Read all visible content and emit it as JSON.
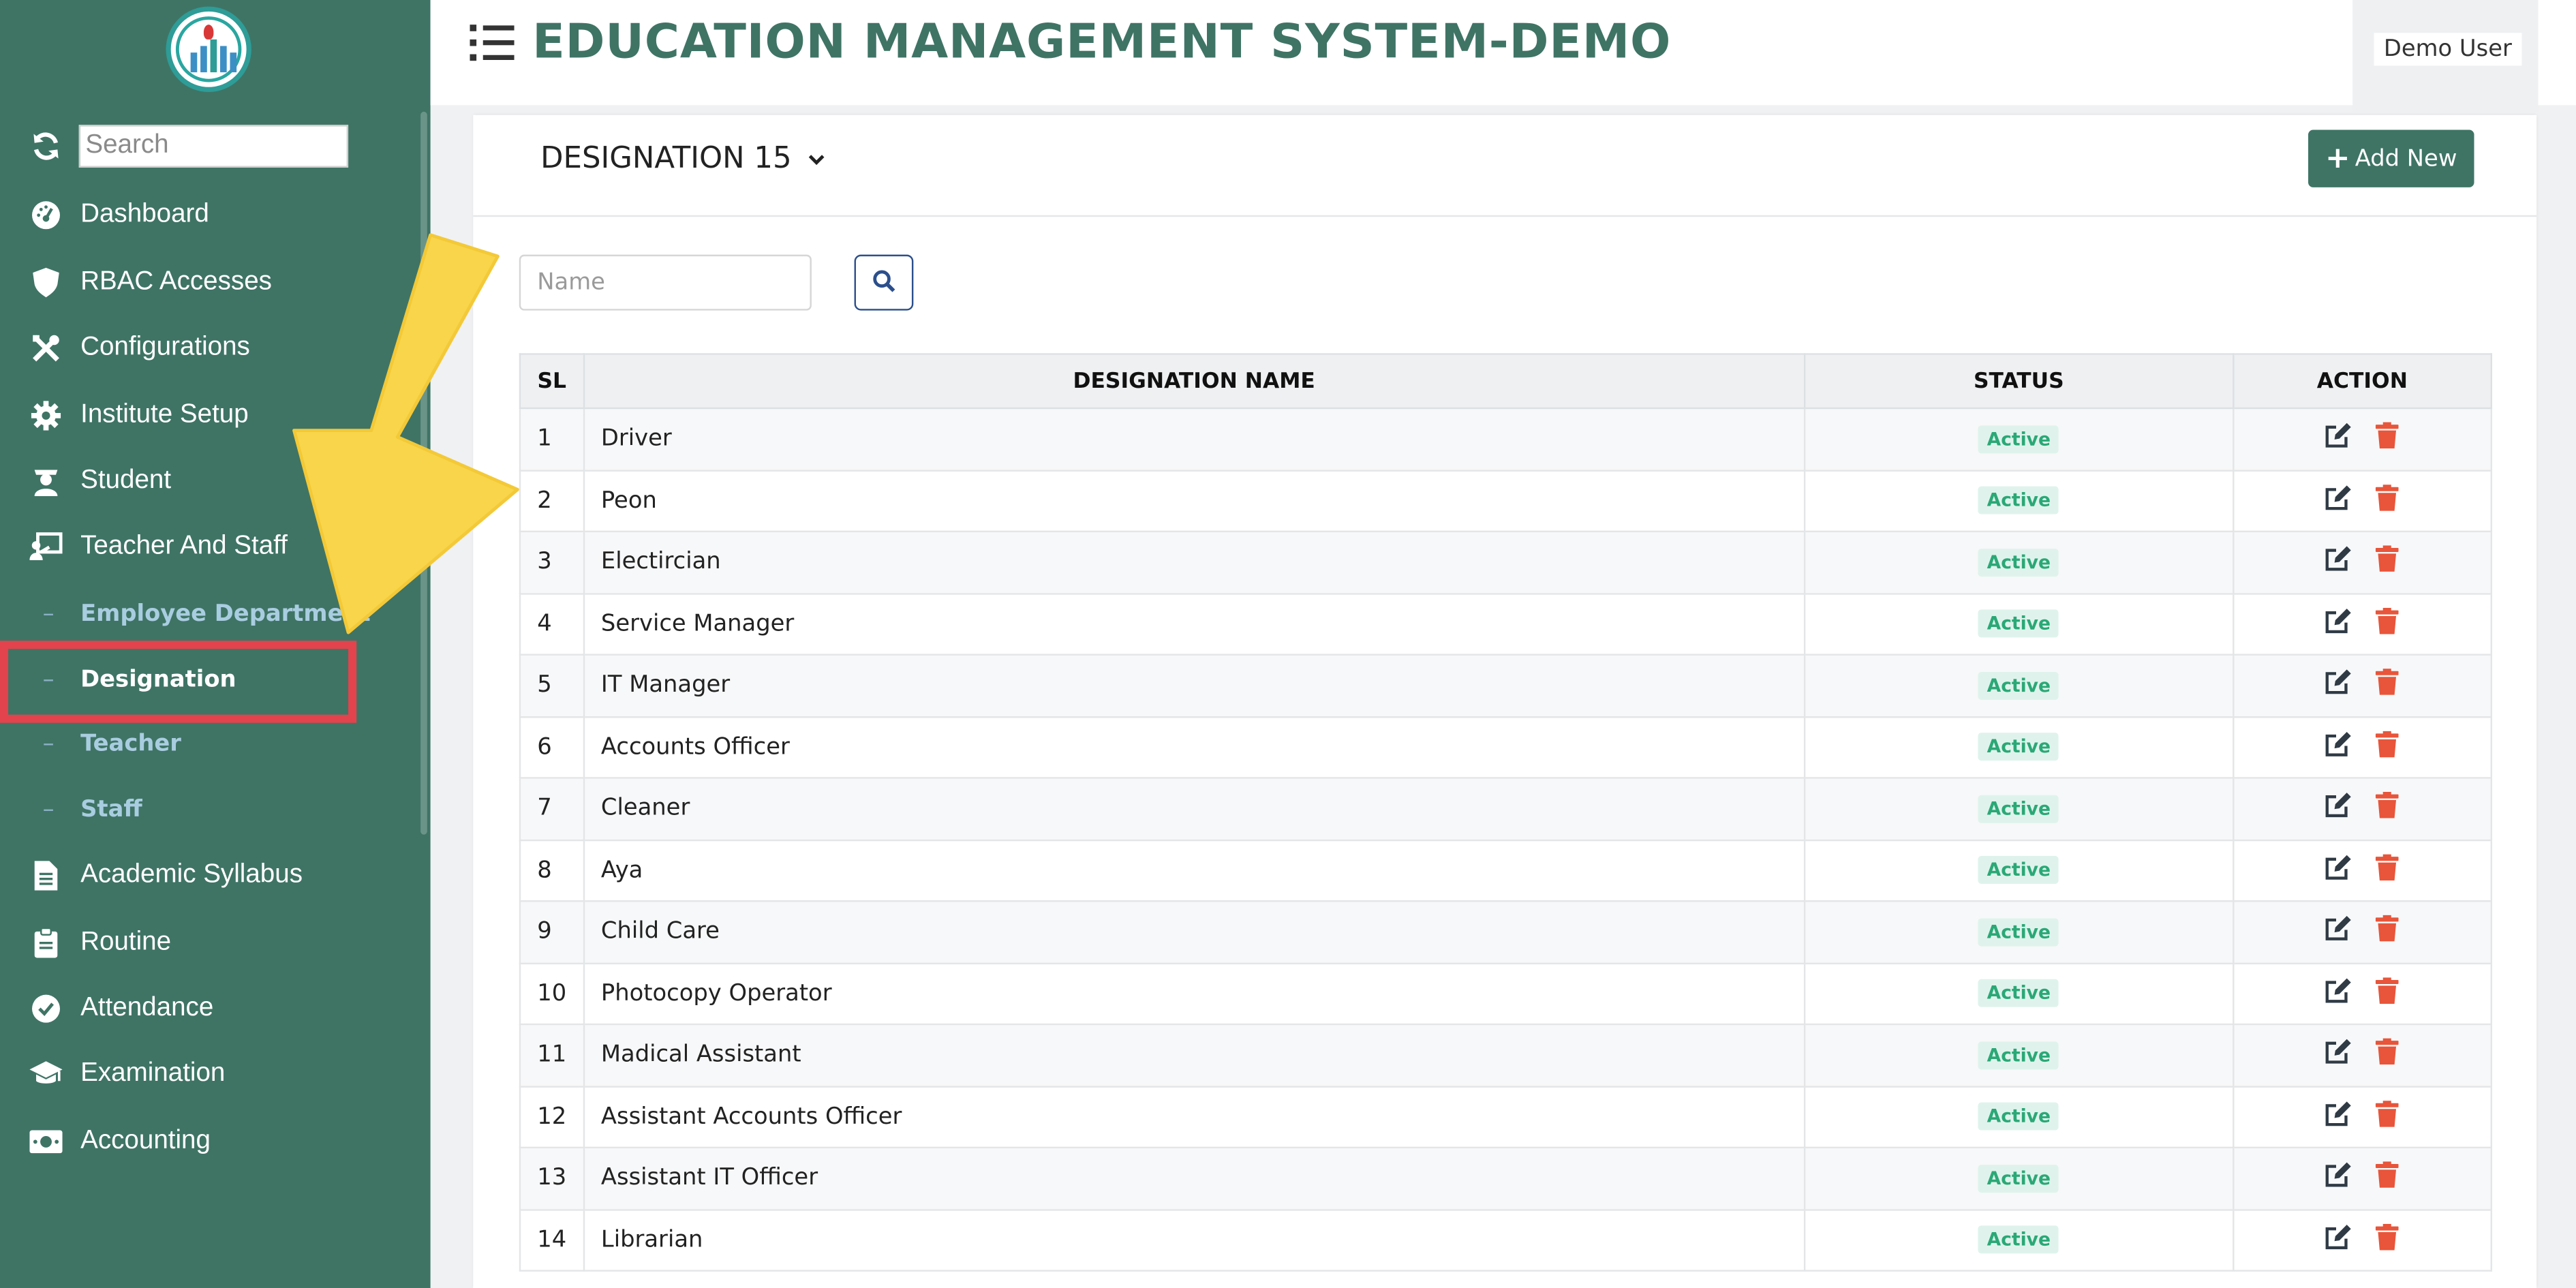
{
  "app": {
    "title": "EDUCATION MANAGEMENT SYSTEM-DEMO",
    "user": "Demo User"
  },
  "sidebar": {
    "search_placeholder": "Search",
    "items": [
      {
        "label": "Dashboard",
        "icon": "dashboard-icon"
      },
      {
        "label": "RBAC Accesses",
        "icon": "shield-icon"
      },
      {
        "label": "Configurations",
        "icon": "tools-icon"
      },
      {
        "label": "Institute Setup",
        "icon": "gear-icon"
      },
      {
        "label": "Student",
        "icon": "student-icon"
      },
      {
        "label": "Teacher And Staff",
        "icon": "teacher-icon"
      },
      {
        "label": "Academic Syllabus",
        "icon": "document-icon"
      },
      {
        "label": "Routine",
        "icon": "clipboard-icon"
      },
      {
        "label": "Attendance",
        "icon": "check-circle-icon"
      },
      {
        "label": "Examination",
        "icon": "graduation-cap-icon"
      },
      {
        "label": "Accounting",
        "icon": "money-icon"
      }
    ],
    "subitems": [
      {
        "label": "Employee Department"
      },
      {
        "label": "Designation",
        "active": true
      },
      {
        "label": "Teacher"
      },
      {
        "label": "Staff"
      }
    ]
  },
  "page": {
    "title": "DESIGNATION 15",
    "add_label": "Add New",
    "name_placeholder": "Name"
  },
  "table": {
    "headers": [
      "SL",
      "DESIGNATION NAME",
      "STATUS",
      "ACTION"
    ],
    "rows": [
      {
        "sl": "1",
        "name": "Driver",
        "status": "Active"
      },
      {
        "sl": "2",
        "name": "Peon",
        "status": "Active"
      },
      {
        "sl": "3",
        "name": "Electircian",
        "status": "Active"
      },
      {
        "sl": "4",
        "name": "Service Manager",
        "status": "Active"
      },
      {
        "sl": "5",
        "name": "IT Manager",
        "status": "Active"
      },
      {
        "sl": "6",
        "name": "Accounts Officer",
        "status": "Active"
      },
      {
        "sl": "7",
        "name": "Cleaner",
        "status": "Active"
      },
      {
        "sl": "8",
        "name": "Aya",
        "status": "Active"
      },
      {
        "sl": "9",
        "name": "Child Care",
        "status": "Active"
      },
      {
        "sl": "10",
        "name": "Photocopy Operator",
        "status": "Active"
      },
      {
        "sl": "11",
        "name": "Madical Assistant",
        "status": "Active"
      },
      {
        "sl": "12",
        "name": "Assistant Accounts Officer",
        "status": "Active"
      },
      {
        "sl": "13",
        "name": "Assistant IT Officer",
        "status": "Active"
      },
      {
        "sl": "14",
        "name": "Librarian",
        "status": "Active"
      }
    ]
  },
  "colors": {
    "primary": "#3f7465",
    "highlight": "#e3434d",
    "arrow": "#f8d54a",
    "active_badge": "#2aa876",
    "delete": "#e8553a"
  }
}
